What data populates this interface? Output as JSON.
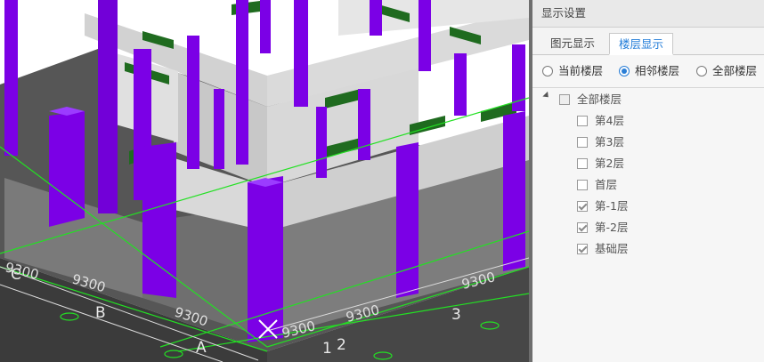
{
  "viewport": {
    "axis_labels": [
      "C",
      "B",
      "A",
      "1",
      "2",
      "3"
    ],
    "dim_labels": [
      "9300",
      "9300",
      "9300",
      "9300",
      "9300",
      "9300"
    ],
    "colors": {
      "column": "#7b00e6",
      "wall": "#d4d4d4",
      "beam": "#1f6b1f",
      "floor": "#6d6d6d",
      "grid": "#23e023"
    }
  },
  "panel": {
    "title": "显示设置",
    "tabs": [
      {
        "label": "图元显示"
      },
      {
        "label": "楼层显示"
      }
    ],
    "active_tab": "楼层显示",
    "radios": [
      {
        "label": "当前楼层"
      },
      {
        "label": "相邻楼层"
      },
      {
        "label": "全部楼层"
      }
    ],
    "selected_radio": "相邻楼层",
    "tree": {
      "root_label": "全部楼层",
      "items": [
        {
          "label": "第4层",
          "checked": false
        },
        {
          "label": "第3层",
          "checked": false
        },
        {
          "label": "第2层",
          "checked": false
        },
        {
          "label": "首层",
          "checked": false
        },
        {
          "label": "第-1层",
          "checked": true
        },
        {
          "label": "第-2层",
          "checked": true
        },
        {
          "label": "基础层",
          "checked": true
        }
      ]
    }
  }
}
